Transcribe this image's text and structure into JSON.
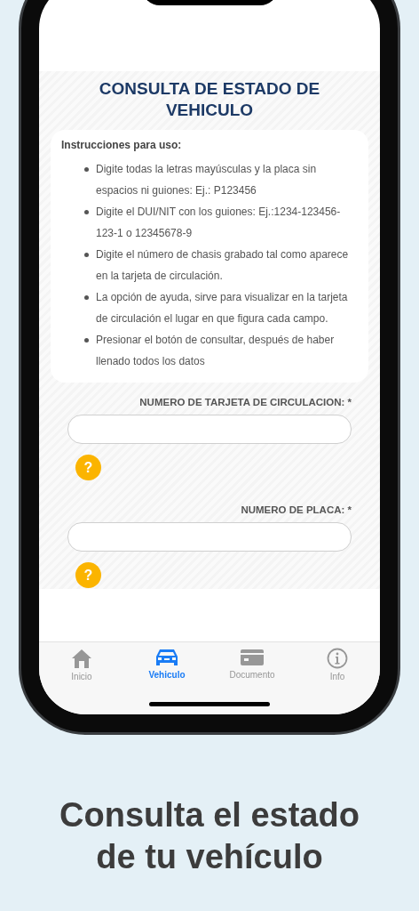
{
  "page": {
    "title": "CONSULTA DE ESTADO DE VEHICULO"
  },
  "instructions": {
    "heading": "Instrucciones para uso:",
    "items": [
      "Digite todas la letras mayúsculas y la placa sin espacios ni guiones: Ej.: P123456",
      "Digite el DUI/NIT con los guiones: Ej.:1234-123456-123-1 o 12345678-9",
      "Digite el número de chasis grabado tal como aparece en la tarjeta de circulación.",
      "La opción de ayuda, sirve para visualizar en la tarjeta de circulación el lugar en que figura cada campo.",
      "Presionar el botón de consultar, después de haber llenado todos los datos"
    ]
  },
  "fields": [
    {
      "label": "NUMERO DE TARJETA DE CIRCULACION: *",
      "help": "?"
    },
    {
      "label": "NUMERO DE PLACA: *",
      "help": "?"
    }
  ],
  "tabs": [
    {
      "label": "Inicio",
      "selected": false
    },
    {
      "label": "Vehiculo",
      "selected": true
    },
    {
      "label": "Documento",
      "selected": false
    },
    {
      "label": "Info",
      "selected": false
    }
  ],
  "caption": [
    "Consulta el estado",
    "de tu vehículo"
  ]
}
